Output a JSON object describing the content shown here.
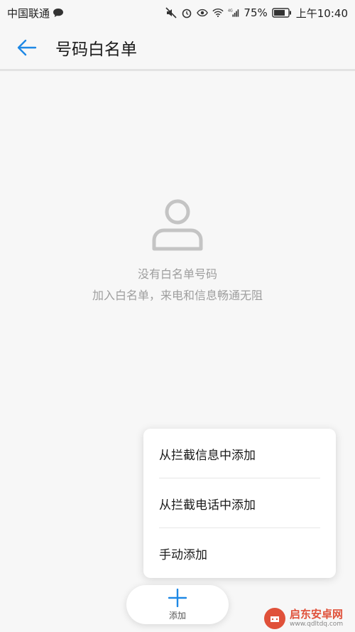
{
  "status_bar": {
    "carrier": "中国联通",
    "battery": "75%",
    "time": "上午10:40",
    "network": "4G"
  },
  "header": {
    "title": "号码白名单"
  },
  "empty_state": {
    "line1": "没有白名单号码",
    "line2": "加入白名单，来电和信息畅通无阻"
  },
  "menu": {
    "items": [
      {
        "label": "从拦截信息中添加"
      },
      {
        "label": "从拦截电话中添加"
      },
      {
        "label": "手动添加"
      }
    ]
  },
  "add_button": {
    "label": "添加"
  },
  "watermark": {
    "name": "启东安卓网",
    "url": "www.qdltdq.com"
  },
  "colors": {
    "accent": "#1e88e5",
    "background": "#f7f7f7",
    "hint_text": "#9e9e9e"
  }
}
